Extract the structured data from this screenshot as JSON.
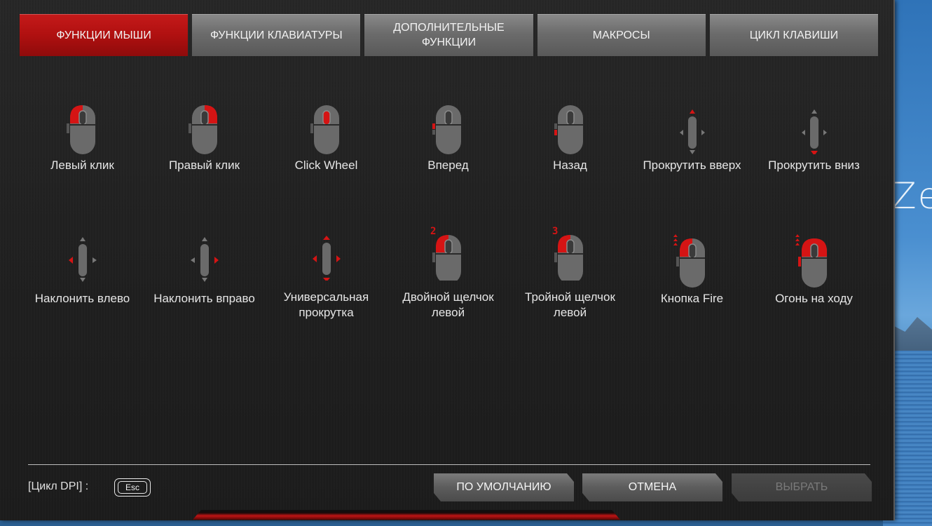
{
  "tabs": [
    {
      "label": "ФУНКЦИИ МЫШИ",
      "active": true
    },
    {
      "label": "ФУНКЦИИ КЛАВИАТУРЫ",
      "active": false
    },
    {
      "label": "ДОПОЛНИТЕЛЬНЫЕ\nФУНКЦИИ",
      "active": false
    },
    {
      "label": "МАКРОСЫ",
      "active": false
    },
    {
      "label": "ЦИКЛ КЛАВИШИ",
      "active": false
    }
  ],
  "functions": [
    {
      "label": "Левый клик",
      "icon": "mouse-left-click-icon"
    },
    {
      "label": "Правый клик",
      "icon": "mouse-right-click-icon"
    },
    {
      "label": "Click Wheel",
      "icon": "mouse-wheel-click-icon"
    },
    {
      "label": "Вперед",
      "icon": "mouse-forward-icon"
    },
    {
      "label": "Назад",
      "icon": "mouse-back-icon"
    },
    {
      "label": "Прокрутить вверх",
      "icon": "scroll-up-icon"
    },
    {
      "label": "Прокрутить вниз",
      "icon": "scroll-down-icon"
    },
    {
      "label": "Наклонить влево",
      "icon": "tilt-left-icon"
    },
    {
      "label": "Наклонить вправо",
      "icon": "tilt-right-icon"
    },
    {
      "label": "Универсальная\nпрокрутка",
      "icon": "universal-scroll-icon"
    },
    {
      "label": "Двойной щелчок\nлевой",
      "icon": "double-click-icon",
      "badge": "2"
    },
    {
      "label": "Тройной щелчок\nлевой",
      "icon": "triple-click-icon",
      "badge": "3"
    },
    {
      "label": "Кнопка Fire",
      "icon": "fire-button-icon"
    },
    {
      "label": "Огонь на ходу",
      "icon": "fire-on-move-icon"
    }
  ],
  "footer": {
    "dpi_label": "[Цикл DPI] :",
    "esc_key": "Esc",
    "default_button": "ПО УМОЛЧАНИЮ",
    "cancel_button": "ОТМЕНА",
    "select_button": "ВЫБРАТЬ"
  },
  "colors": {
    "accent": "#d51414",
    "tab_active": "#b81111",
    "tab_inactive": "#6b6b6b",
    "mouse_body": "#6a6a6a"
  },
  "desktop_text": "Ze"
}
